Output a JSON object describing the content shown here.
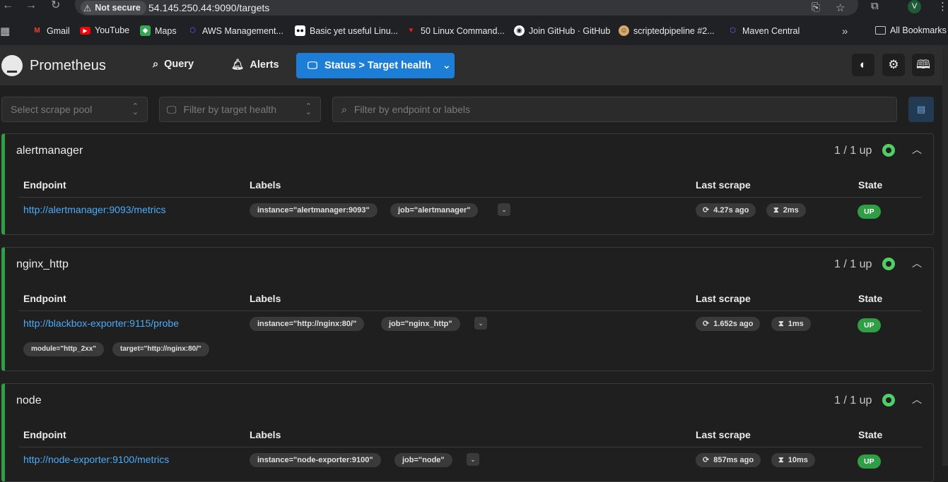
{
  "browser": {
    "security_label": "Not secure",
    "url": "54.145.250.44:9090/targets",
    "avatar_letter": "V",
    "bookmarks": [
      {
        "label": "Gmail",
        "icon": "gmail-icon",
        "color": "#ea4335"
      },
      {
        "label": "YouTube",
        "icon": "youtube-icon",
        "color": "#ff0000"
      },
      {
        "label": "Maps",
        "icon": "maps-icon",
        "color": "#34a853"
      },
      {
        "label": "AWS Management...",
        "icon": "aws-icon",
        "color": "#8c4fff"
      },
      {
        "label": "Basic yet useful Linu...",
        "icon": "medium-icon",
        "color": "#ffffff"
      },
      {
        "label": "50 Linux Command...",
        "icon": "tecmint-icon",
        "color": "#e02020"
      },
      {
        "label": "Join GitHub · GitHub",
        "icon": "github-icon",
        "color": "#ffffff"
      },
      {
        "label": "scriptedpipeline #2...",
        "icon": "jenkins-icon",
        "color": "#d9a86c"
      },
      {
        "label": "Maven Central",
        "icon": "maven-icon",
        "color": "#7b68ee"
      }
    ],
    "all_bookmarks_label": "All Bookmarks"
  },
  "header": {
    "brand": "Prometheus",
    "nav_query": "Query",
    "nav_alerts": "Alerts",
    "status_menu": "Status > Target health"
  },
  "filters": {
    "scrape_pool_placeholder": "Select scrape pool",
    "health_placeholder": "Filter by target health",
    "search_placeholder": "Filter by endpoint or labels"
  },
  "columns": {
    "endpoint": "Endpoint",
    "labels": "Labels",
    "last_scrape": "Last scrape",
    "state": "State"
  },
  "pools": [
    {
      "name": "alertmanager",
      "count": "1 / 1 up",
      "endpoint": "http://alertmanager:9093/metrics",
      "labels": [
        "instance=\"alertmanager:9093\"",
        "job=\"alertmanager\""
      ],
      "extra_labels": [],
      "last_scrape": "4.27s ago",
      "duration": "2ms",
      "state": "UP"
    },
    {
      "name": "nginx_http",
      "count": "1 / 1 up",
      "endpoint": "http://blackbox-exporter:9115/probe",
      "labels": [
        "instance=\"http://nginx:80/\"",
        "job=\"nginx_http\""
      ],
      "extra_labels": [
        "module=\"http_2xx\"",
        "target=\"http://nginx:80/\""
      ],
      "last_scrape": "1.652s ago",
      "duration": "1ms",
      "state": "UP"
    },
    {
      "name": "node",
      "count": "1 / 1 up",
      "endpoint": "http://node-exporter:9100/metrics",
      "labels": [
        "instance=\"node-exporter:9100\"",
        "job=\"node\""
      ],
      "extra_labels": [],
      "last_scrape": "857ms ago",
      "duration": "10ms",
      "state": "UP"
    }
  ],
  "colors": {
    "accent": "#1c7ed6",
    "up": "#2f9e44",
    "link": "#4dabf7"
  }
}
